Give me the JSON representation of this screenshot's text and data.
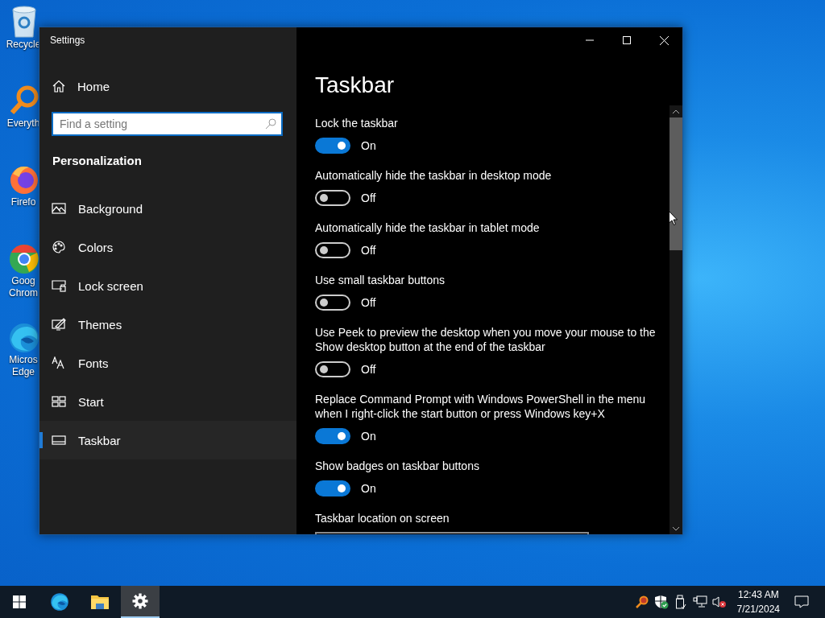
{
  "desktop": {
    "icons": [
      {
        "kind": "recycle",
        "lines": [
          "Recycle"
        ]
      },
      {
        "kind": "search",
        "lines": [
          "Everyth"
        ]
      },
      {
        "kind": "firefox",
        "lines": [
          "Firefo"
        ]
      },
      {
        "kind": "chrome",
        "lines": [
          "Goog",
          "Chrom"
        ]
      },
      {
        "kind": "edge",
        "lines": [
          "Micros",
          "Edge"
        ]
      }
    ]
  },
  "window": {
    "title": "Settings",
    "sidebar": {
      "home": "Home",
      "search": {
        "placeholder": "Find a setting"
      },
      "section": "Personalization",
      "items": [
        {
          "kind": "background",
          "label": "Background",
          "selected": false
        },
        {
          "kind": "colors",
          "label": "Colors",
          "selected": false
        },
        {
          "kind": "lock",
          "label": "Lock screen",
          "selected": false
        },
        {
          "kind": "themes",
          "label": "Themes",
          "selected": false
        },
        {
          "kind": "fonts",
          "label": "Fonts",
          "selected": false
        },
        {
          "kind": "start",
          "label": "Start",
          "selected": false
        },
        {
          "kind": "taskbar",
          "label": "Taskbar",
          "selected": true
        }
      ]
    },
    "content": {
      "title": "Taskbar",
      "settings": [
        {
          "label": "Lock the taskbar",
          "on": true,
          "state_text": "On"
        },
        {
          "label": "Automatically hide the taskbar in desktop mode",
          "on": false,
          "state_text": "Off"
        },
        {
          "label": "Automatically hide the taskbar in tablet mode",
          "on": false,
          "state_text": "Off"
        },
        {
          "label": "Use small taskbar buttons",
          "on": false,
          "state_text": "Off"
        },
        {
          "label": "Use Peek to preview the desktop when you move your mouse to the Show desktop button at the end of the taskbar",
          "on": false,
          "state_text": "Off"
        },
        {
          "label": "Replace Command Prompt with Windows PowerShell in the menu when I right-click the start button or press Windows key+X",
          "on": true,
          "state_text": "On"
        },
        {
          "label": "Show badges on taskbar buttons",
          "on": true,
          "state_text": "On"
        }
      ],
      "location": {
        "label": "Taskbar location on screen"
      }
    }
  },
  "taskbar": {
    "apps": [
      {
        "kind": "start",
        "selected": false
      },
      {
        "kind": "edge",
        "selected": false
      },
      {
        "kind": "explorer",
        "selected": false
      },
      {
        "kind": "settings",
        "selected": true
      }
    ],
    "tray": [
      {
        "kind": "search"
      },
      {
        "kind": "shield"
      },
      {
        "kind": "usb"
      },
      {
        "kind": "network"
      },
      {
        "kind": "volume-muted"
      }
    ],
    "time": "12:43 AM",
    "date": "7/21/2024"
  }
}
